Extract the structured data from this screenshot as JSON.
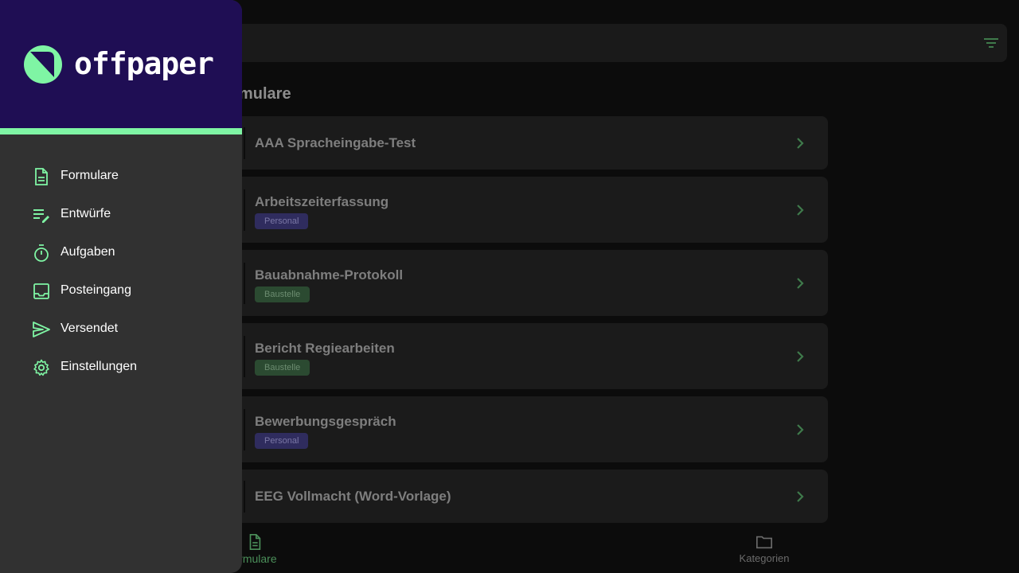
{
  "brand": {
    "name": "offpaper",
    "accent": "#7ff5a4",
    "header_color": "#1f0e54"
  },
  "main": {
    "section_title": "ormulare",
    "forms": [
      {
        "title": "AAA Spracheingabe-Test",
        "tag": null
      },
      {
        "title": "Arbeitszeiterfassung",
        "tag": "Personal"
      },
      {
        "title": "Bauabnahme-Protokoll",
        "tag": "Baustelle"
      },
      {
        "title": "Bericht Regiearbeiten",
        "tag": "Baustelle"
      },
      {
        "title": "Bewerbungsgespräch",
        "tag": "Personal"
      },
      {
        "title": "EEG Vollmacht (Word-Vorlage)",
        "tag": null
      }
    ]
  },
  "bottom_nav": {
    "forms_label": "ormulare",
    "categories_label": "Kategorien"
  },
  "drawer": {
    "items": [
      {
        "label": "Formulare",
        "icon": "document-icon"
      },
      {
        "label": "Entwürfe",
        "icon": "drafts-icon"
      },
      {
        "label": "Aufgaben",
        "icon": "timer-icon"
      },
      {
        "label": "Posteingang",
        "icon": "inbox-icon"
      },
      {
        "label": "Versendet",
        "icon": "send-icon"
      },
      {
        "label": "Einstellungen",
        "icon": "gear-icon"
      }
    ]
  }
}
